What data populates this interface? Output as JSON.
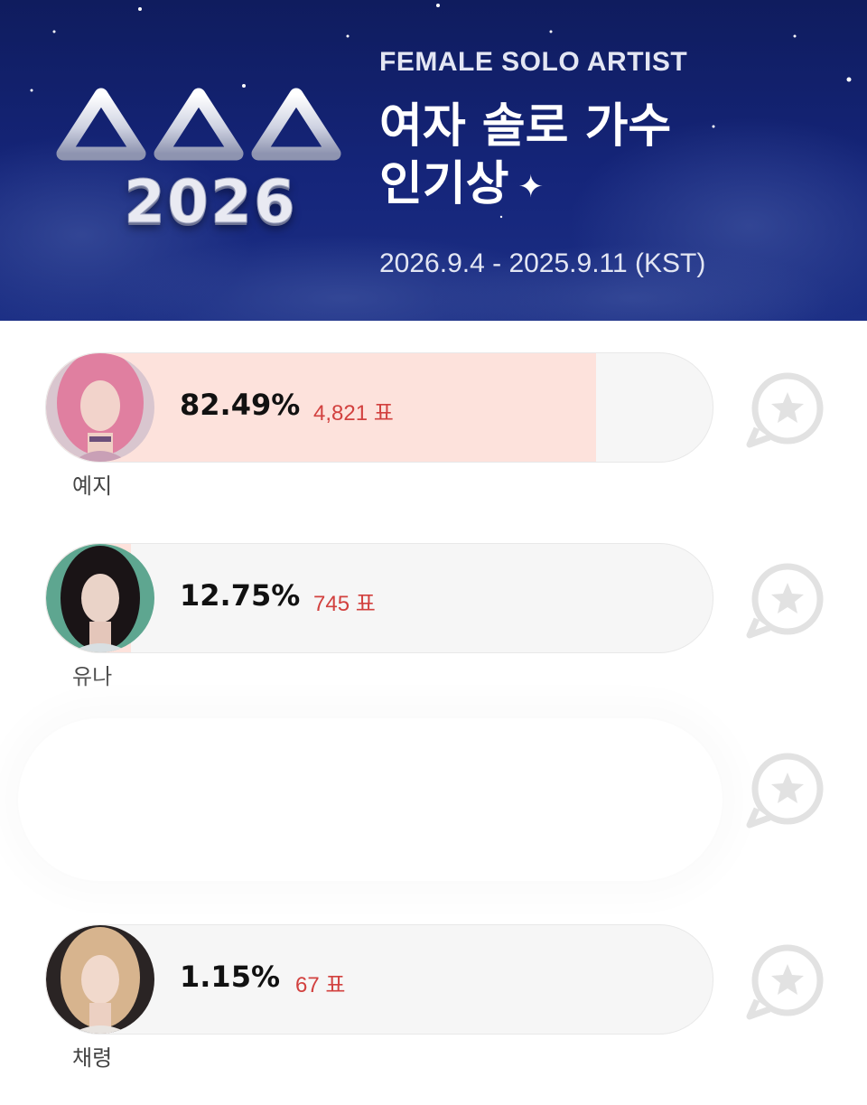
{
  "banner": {
    "logo_top": "AAA",
    "logo_year": "2026",
    "subtitle": "FEMALE SOLO ARTIST",
    "title_line1": "여자 솔로 가수",
    "title_line2": "인기상",
    "sparkle": "✦",
    "dates": "2026.9.4 - 2025.9.11 (KST)",
    "bg_color": "#15257a"
  },
  "entries": [
    {
      "name": "예지",
      "percent": "82.49%",
      "votes": "4,821 표",
      "share": 0.8249,
      "fill_color": "#fde2dc"
    },
    {
      "name": "유나",
      "percent": "12.75%",
      "votes": "745 표",
      "share": 0.1275,
      "fill_color": "#fde2dc"
    },
    {
      "name": "채령",
      "percent": "1.15%",
      "votes": "67 표",
      "share": 0.0115,
      "fill_color": "#fde2dc"
    }
  ],
  "vote_icon": "star-speech-bubble-icon",
  "colors": {
    "vote_count": "#d2413f",
    "bar_track": "#f6f6f6",
    "icon_gray": "#e2e2e2"
  }
}
